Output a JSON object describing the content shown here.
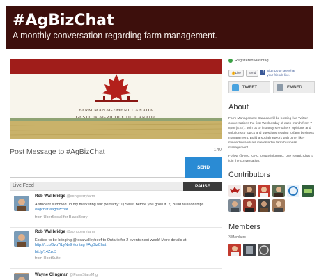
{
  "header": {
    "title": "#AgBizChat",
    "subtitle": "A monthly conversation regarding farm management."
  },
  "banner": {
    "org_en": "FARM MANAGEMENT CANADA",
    "org_fr": "GESTION AGRICOLE DU CANADA"
  },
  "compose": {
    "title": "Post Message to #AgBizChat",
    "char_count": "140",
    "placeholder": "",
    "send_label": "SEND"
  },
  "feed": {
    "label": "Live Feed",
    "pause_label": "PAUSE",
    "tweets": [
      {
        "name": "Rob Wallbridge",
        "handle": "@songberryfarm",
        "lines": [
          "A student summed up my marketing talk perfectly: 1) Sell it before you grow it. 2) Build relationships.",
          "#agchat #agbizchat"
        ],
        "source": "from UberSocial for BlackBerry"
      },
      {
        "name": "Rob Wallbridge",
        "handle": "@songberryfarm",
        "lines": [
          "Excited to be bringing @localvalleybeef to Ontario for 2 events next week! More details at",
          "http://t.co/6vu7tLyNe9 #ontag #AgBizChat",
          "bit.ly/14Zzq3"
        ],
        "source": "from HootSuite"
      },
      {
        "name": "Wayne Clingman",
        "handle": "@FarmStarsMfg",
        "lines": [],
        "source": ""
      }
    ]
  },
  "sidebar": {
    "registered": "Registered Hashtag",
    "like_label": "Like",
    "send_label": "Send",
    "fb_text": "Sign Up to see what your friends like.",
    "tweet_button": "TWEET",
    "embed_button": "EMBED",
    "about_title": "About",
    "about_p1": "Farm Management Canada will be hosting live Twitter conversations the first Wednesday of each month from 7-8pm (EST). Join us to instantly see others' opinions and solutions to topics and questions relating to farm business management. Build a social network with other like-minded individuals interested in farm business management.",
    "about_p2": "Follow @FMC_GAC to stay informed. Use #AgBizChat to join the conversation.",
    "contributors_title": "Contributors",
    "members_title": "Members",
    "members_count": "3 Members"
  },
  "colors": {
    "header_bg": "#3d0f0c",
    "accent_red": "#a01d1a",
    "send_blue": "#2a8bd4"
  }
}
